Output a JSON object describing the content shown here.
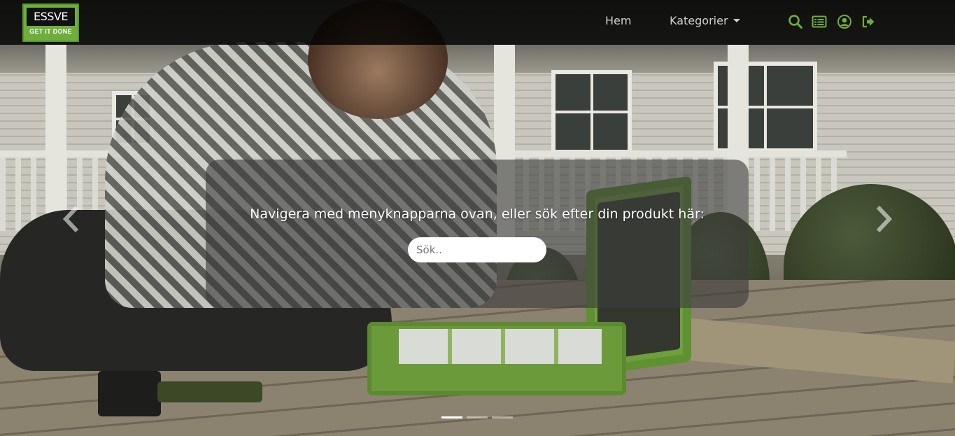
{
  "brand": {
    "logo_name": "ESSVE",
    "logo_tagline": "GET IT DONE",
    "accent_color": "#6fae3c"
  },
  "nav": {
    "home_label": "Hem",
    "categories_label": "Kategorier",
    "icons": [
      "search-icon",
      "list-icon",
      "user-icon",
      "logout-icon"
    ]
  },
  "hero": {
    "prompt": "Navigera med menyknapparna ovan, eller sök efter din produkt här:",
    "search_placeholder": "Sök..",
    "slides_count": 3,
    "active_slide": 1
  }
}
